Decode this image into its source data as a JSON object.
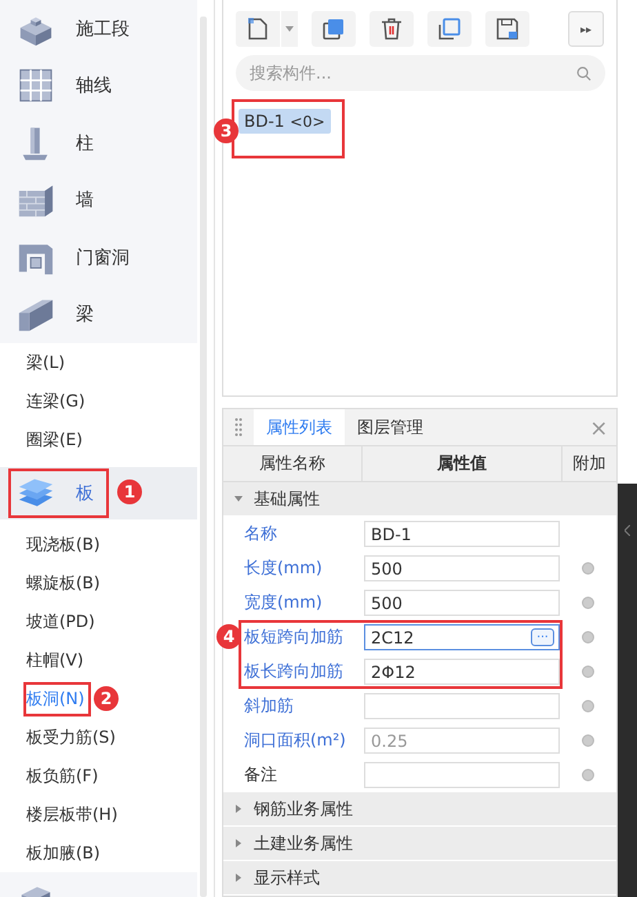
{
  "sidebar": {
    "items": [
      {
        "kind": "category",
        "label": "施工段",
        "selected": false
      },
      {
        "kind": "category",
        "label": "轴线",
        "selected": false
      },
      {
        "kind": "category",
        "label": "柱",
        "selected": false
      },
      {
        "kind": "category",
        "label": "墙",
        "selected": false
      },
      {
        "kind": "category",
        "label": "门窗洞",
        "selected": false
      },
      {
        "kind": "category",
        "label": "梁",
        "selected": false
      },
      {
        "kind": "sub",
        "label": "梁(L)",
        "selected": false
      },
      {
        "kind": "sub",
        "label": "连梁(G)",
        "selected": false
      },
      {
        "kind": "sub",
        "label": "圈梁(E)",
        "selected": false
      },
      {
        "kind": "category",
        "label": "板",
        "selected": true,
        "annotation": "1"
      },
      {
        "kind": "sub",
        "label": "现浇板(B)",
        "selected": false
      },
      {
        "kind": "sub",
        "label": "螺旋板(B)",
        "selected": false
      },
      {
        "kind": "sub",
        "label": "坡道(PD)",
        "selected": false
      },
      {
        "kind": "sub",
        "label": "柱帽(V)",
        "selected": false
      },
      {
        "kind": "sub",
        "label": "板洞(N)",
        "selected": true,
        "annotation": "2"
      },
      {
        "kind": "sub",
        "label": "板受力筋(S)",
        "selected": false
      },
      {
        "kind": "sub",
        "label": "板负筋(F)",
        "selected": false
      },
      {
        "kind": "sub",
        "label": "楼层板带(H)",
        "selected": false
      },
      {
        "kind": "sub",
        "label": "板加腋(B)",
        "selected": false
      },
      {
        "kind": "category"
      }
    ]
  },
  "toolbar": {
    "more": "▸▸"
  },
  "search": {
    "placeholder": "搜索构件..."
  },
  "components": [
    {
      "label": "BD-1",
      "count": "<0>",
      "selected": true,
      "annotation": "3"
    }
  ],
  "properties": {
    "tabs": [
      {
        "label": "属性列表",
        "selected": true
      },
      {
        "label": "图层管理",
        "selected": false
      }
    ],
    "close": "×",
    "columns": [
      "属性名称",
      "属性值",
      "附加"
    ],
    "groups": [
      {
        "label": "基础属性",
        "expanded": true,
        "rows": [
          {
            "name": "名称",
            "public": true,
            "value": "BD-1",
            "readonly": false
          },
          {
            "name": "长度(mm)",
            "public": true,
            "value": "500",
            "readonly": false,
            "extra": true
          },
          {
            "name": "宽度(mm)",
            "public": true,
            "value": "500",
            "readonly": false,
            "extra": true
          },
          {
            "name": "板短跨向加筋",
            "public": true,
            "value": "2C12",
            "readonly": false,
            "extra": true,
            "button": "···",
            "framed": true,
            "annotation": "4"
          },
          {
            "name": "板长跨向加筋",
            "public": true,
            "value": "2Φ12",
            "readonly": false,
            "extra": true,
            "framed": true
          },
          {
            "name": "斜加筋",
            "public": true,
            "value": "",
            "readonly": false,
            "extra": true
          },
          {
            "name": "洞口面积(m²)",
            "public": true,
            "value": "0.25",
            "readonly": true,
            "extra": true
          },
          {
            "name": "备注",
            "public": false,
            "value": "",
            "readonly": false,
            "extra": true
          }
        ]
      },
      {
        "label": "钢筋业务属性",
        "expanded": false
      },
      {
        "label": "土建业务属性",
        "expanded": false
      },
      {
        "label": "显示样式",
        "expanded": false
      }
    ]
  }
}
